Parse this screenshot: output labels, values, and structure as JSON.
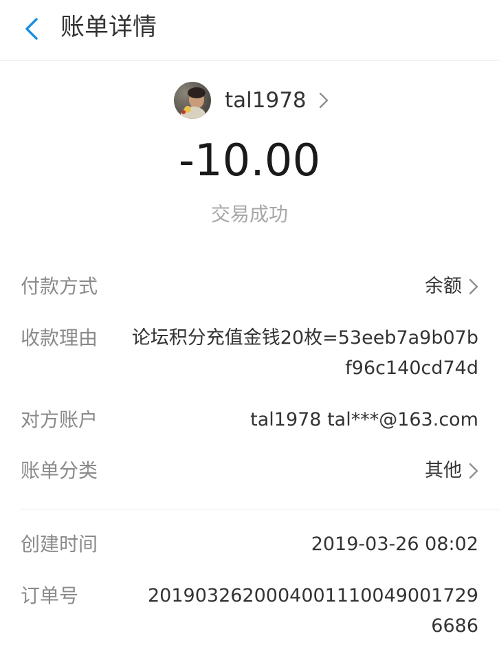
{
  "header": {
    "title": "账单详情",
    "back_icon": "chevron-left-icon"
  },
  "counterparty": {
    "name": "tal1978",
    "avatar_icon": "avatar-photo"
  },
  "transaction": {
    "amount": "-10.00",
    "status": "交易成功"
  },
  "details": {
    "payment_method": {
      "label": "付款方式",
      "value": "余额"
    },
    "reason": {
      "label": "收款理由",
      "value": "论坛积分充值金钱20枚=53eeb7a9b07bf96c140cd74d"
    },
    "account": {
      "label": "对方账户",
      "value": "tal1978 tal***@163.com"
    },
    "category": {
      "label": "账单分类",
      "value": "其他"
    },
    "created": {
      "label": "创建时间",
      "value": "2019-03-26 08:02"
    },
    "order": {
      "label": "订单号",
      "value": "2019032620004001110049001729 6686"
    }
  },
  "colors": {
    "accent": "#1a8fe3",
    "label_gray": "#8a8a8a",
    "status_gray": "#a7a7a7",
    "text_dark": "#333333"
  }
}
